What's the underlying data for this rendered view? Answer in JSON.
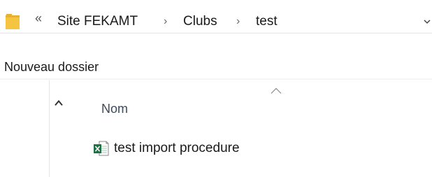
{
  "address_bar": {
    "overflow_glyph": "«",
    "separator_glyph": "›",
    "crumbs": [
      "Site FEKAMT",
      "Clubs",
      "test"
    ],
    "folder_icon": "folder-icon",
    "dropdown_icon": "chevron-down-icon"
  },
  "toolbar": {
    "new_folder_label": "Nouveau dossier"
  },
  "file_list": {
    "column_name_label": "Nom",
    "sort_icon": "sort-up-icon",
    "files": [
      {
        "name": "test import procedure",
        "icon": "excel-icon"
      }
    ]
  },
  "colors": {
    "folder": "#F5C542",
    "excel_green": "#1E7145"
  }
}
